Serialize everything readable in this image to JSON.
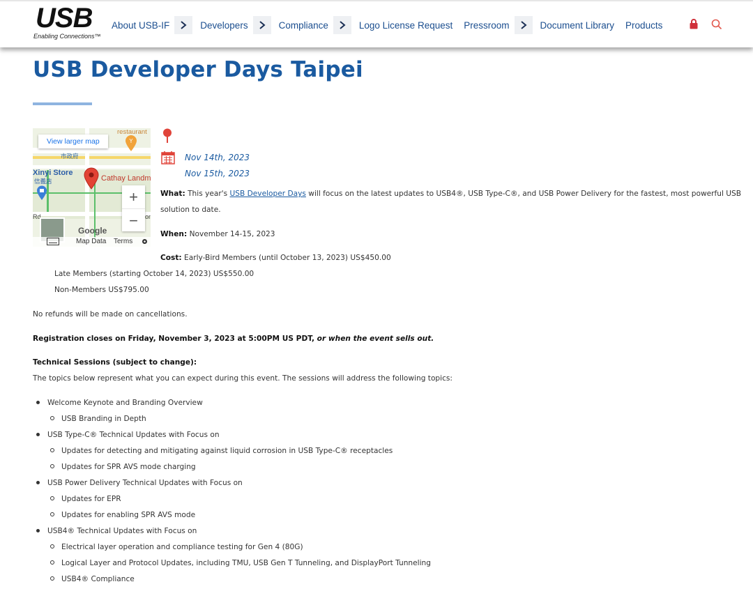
{
  "header": {
    "logo_text": "USB",
    "logo_tagline": "Enabling Connections™",
    "nav": [
      {
        "label": "About USB-IF",
        "has_arrow": true
      },
      {
        "label": "Developers",
        "has_arrow": true
      },
      {
        "label": "Compliance",
        "has_arrow": true
      },
      {
        "label": "Logo License Request",
        "has_arrow": false
      },
      {
        "label": "Pressroom",
        "has_arrow": true
      },
      {
        "label": "Document Library",
        "has_arrow": false
      },
      {
        "label": "Products",
        "has_arrow": false
      }
    ],
    "icons": {
      "lock": "lock-icon",
      "search": "search-icon"
    },
    "colors": {
      "nav": "#1b4e8f",
      "lock": "#d0303a",
      "search": "#e2574c"
    }
  },
  "page": {
    "title": "USB Developer Days Taipei",
    "title_color": "#1a5aa0"
  },
  "map": {
    "view_larger": "View larger map",
    "labels": {
      "restaurant": "restaurant",
      "city_hall": "市政府",
      "xinyi_store": "Xinyi Store",
      "xinyi_cn": "信義店",
      "cathay": "Cathay Landm",
      "rd": "Rd",
      "on": "on",
      "google": "Google"
    },
    "zoom_in": "+",
    "zoom_out": "−",
    "footer": {
      "map_data": "Map Data",
      "terms": "Terms"
    }
  },
  "event": {
    "dates": [
      "Nov 14th, 2023",
      "Nov 15th, 2023"
    ],
    "what_label": "What:",
    "what_pre": "This year's ",
    "what_link": "USB Developer Days",
    "what_post": " will focus on the latest updates to USB4®, USB Type-C®, and USB Power Delivery for the fastest, most powerful USB",
    "what_cont": "solution to date.",
    "when_label": "When:",
    "when_value": "November 14-15, 2023",
    "cost_label": "Cost:",
    "cost_lines": [
      "Early-Bird Members (until October 13, 2023)  US$450.00",
      "Late Members (starting October 14, 2023) US$550.00",
      "Non-Members US$795.00"
    ],
    "no_refunds": "No refunds will be made on cancellations.",
    "registration_bold": "Registration closes on Friday, November 3, 2023 at 5:00PM US PDT,",
    "registration_italic": " or when the event sells out.",
    "sessions_heading": "Technical Sessions (subject to change):",
    "sessions_intro": "The topics below represent what you can expect during this event. The sessions will address the following topics:"
  },
  "topics": [
    {
      "label": "Welcome Keynote and Branding Overview",
      "level": 1
    },
    {
      "label": "USB Branding in Depth",
      "level": 2
    },
    {
      "label": "USB Type-C® Technical Updates with Focus on",
      "level": 1
    },
    {
      "label": "Updates for detecting and mitigating against liquid corrosion in USB Type-C® receptacles",
      "level": 2
    },
    {
      "label": "Updates for SPR AVS mode charging",
      "level": 2
    },
    {
      "label": "USB Power Delivery Technical Updates with Focus on",
      "level": 1
    },
    {
      "label": "Updates for EPR",
      "level": 2
    },
    {
      "label": "Updates for enabling SPR AVS mode",
      "level": 2
    },
    {
      "label": "USB4® Technical Updates with Focus on",
      "level": 1
    },
    {
      "label": "Electrical layer operation and compliance testing for Gen 4 (80G)",
      "level": 2
    },
    {
      "label": "Logical Layer and Protocol Updates, including TMU, USB Gen T Tunneling, and DisplayPort Tunneling",
      "level": 2
    },
    {
      "label": "USB4® Compliance",
      "level": 2
    }
  ]
}
